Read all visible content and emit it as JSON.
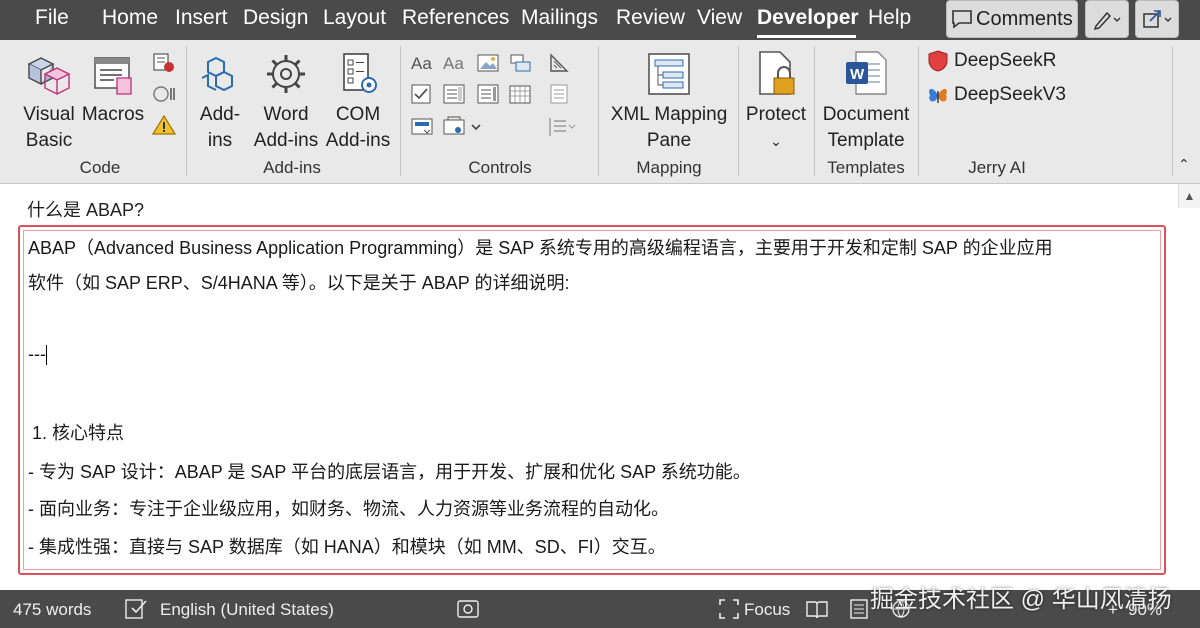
{
  "menubar": {
    "tabs": [
      "File",
      "Home",
      "Insert",
      "Design",
      "Layout",
      "References",
      "Mailings",
      "Review",
      "View",
      "Developer",
      "Help"
    ],
    "active_tab": "Developer",
    "comments_label": "Comments"
  },
  "ribbon": {
    "code": {
      "visual_basic_l1": "Visual",
      "visual_basic_l2": "Basic",
      "macros": "Macros",
      "label": "Code"
    },
    "addins": {
      "addins_l1": "Add-",
      "addins_l2": "ins",
      "word_l1": "Word",
      "word_l2": "Add-ins",
      "com_l1": "COM",
      "com_l2": "Add-ins",
      "label": "Add-ins"
    },
    "controls": {
      "label": "Controls"
    },
    "mapping": {
      "xml_l1": "XML Mapping",
      "xml_l2": "Pane",
      "label": "Mapping"
    },
    "protect": {
      "protect": "Protect"
    },
    "templates": {
      "doc_l1": "Document",
      "doc_l2": "Template",
      "label": "Templates"
    },
    "jerry_ai": {
      "item1": "DeepSeekR",
      "item2": "DeepSeekV3",
      "label": "Jerry AI"
    }
  },
  "document": {
    "question": "什么是 ABAP?",
    "lines": [
      "ABAP（Advanced Business Application Programming）是 SAP 系统专用的高级编程语言，主要用于开发和定制 SAP 的企业应用",
      "软件（如 SAP ERP、S/4HANA 等）。以下是关于 ABAP 的详细说明:",
      "---",
      "1. 核心特点",
      "- 专为 SAP 设计：ABAP 是 SAP 平台的底层语言，用于开发、扩展和优化 SAP 系统功能。",
      "- 面向业务：专注于企业级应用，如财务、物流、人力资源等业务流程的自动化。",
      "- 集成性强：直接与 SAP 数据库（如 HANA）和模块（如 MM、SD、FI）交互。"
    ]
  },
  "statusbar": {
    "words": "475 words",
    "language": "English (United States)",
    "focus": "Focus",
    "zoom": "90%"
  },
  "watermark": "掘金技术社区 @ 华山风清扬",
  "colors": {
    "chrome": "#4a4a4a",
    "ribbon": "#e9e9e9",
    "answer_border": "#d9505a",
    "word_blue": "#2b579a"
  }
}
